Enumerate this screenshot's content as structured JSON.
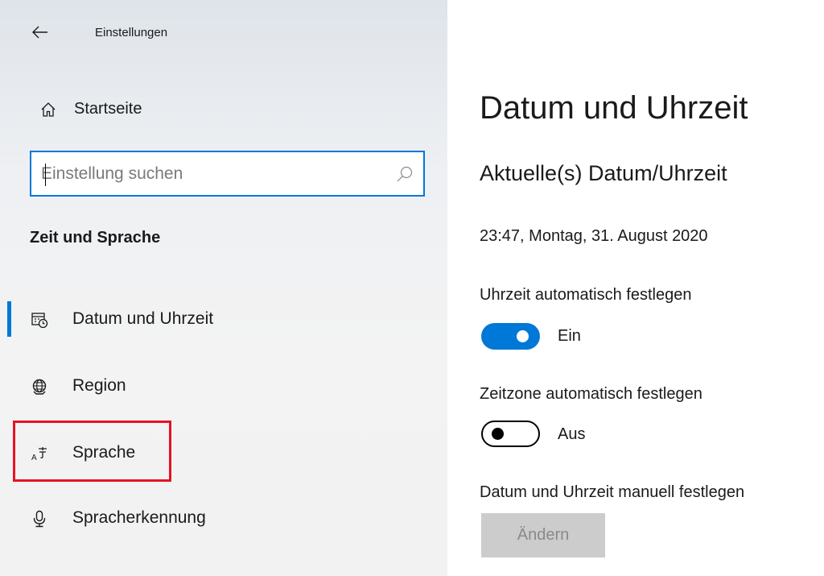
{
  "window": {
    "title": "Einstellungen"
  },
  "sidebar": {
    "home_label": "Startseite",
    "search_placeholder": "Einstellung suchen",
    "section_title": "Zeit und Sprache",
    "items": [
      {
        "label": "Datum und Uhrzeit",
        "icon": "calendar-clock-icon",
        "selected": true
      },
      {
        "label": "Region",
        "icon": "globe-icon",
        "selected": false
      },
      {
        "label": "Sprache",
        "icon": "language-icon",
        "selected": false,
        "highlighted": true
      },
      {
        "label": "Spracherkennung",
        "icon": "microphone-icon",
        "selected": false
      }
    ]
  },
  "main": {
    "title": "Datum und Uhrzeit",
    "subtitle": "Aktuelle(s) Datum/Uhrzeit",
    "current_datetime": "23:47, Montag, 31. August 2020",
    "auto_time": {
      "label": "Uhrzeit automatisch festlegen",
      "state": "Ein",
      "on": true
    },
    "auto_timezone": {
      "label": "Zeitzone automatisch festlegen",
      "state": "Aus",
      "on": false
    },
    "manual": {
      "label": "Datum und Uhrzeit manuell festlegen",
      "button_label": "Ändern",
      "enabled": false
    }
  },
  "colors": {
    "accent": "#0078d7",
    "highlight": "#e81123",
    "disabled_button": "#cccccc"
  }
}
